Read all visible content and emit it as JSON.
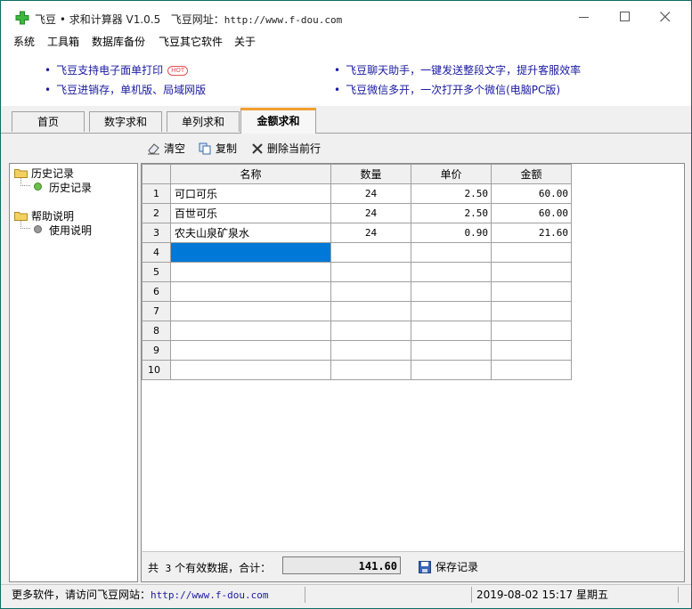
{
  "window": {
    "title": "飞豆 • 求和计算器 V1.0.5",
    "site_label": "飞豆网址：",
    "site_url": "http://www.f-dou.com"
  },
  "menu": [
    "系统",
    "工具箱",
    "数据库备份",
    "飞豆其它软件",
    "关于"
  ],
  "ads": [
    {
      "text": "飞豆支持电子面单打印",
      "badge": "HOT"
    },
    {
      "text": "飞豆聊天助手，一键发送整段文字，提升客服效率"
    },
    {
      "text": "飞豆进销存，单机版、局域网版"
    },
    {
      "text": "飞豆微信多开，一次打开多个微信(电脑PC版)"
    }
  ],
  "tabs": [
    "首页",
    "数字求和",
    "单列求和",
    "金额求和"
  ],
  "active_tab": 3,
  "toolbar": {
    "clear": "清空",
    "copy": "复制",
    "delete_row": "删除当前行"
  },
  "tree": {
    "history_folder": "历史记录",
    "history_item": "历史记录",
    "help_folder": "帮助说明",
    "help_item": "使用说明"
  },
  "grid": {
    "columns": [
      "名称",
      "数量",
      "单价",
      "金额"
    ],
    "rows": [
      {
        "n": "1",
        "name": "可口可乐",
        "qty": "24",
        "price": "2.50",
        "amount": "60.00"
      },
      {
        "n": "2",
        "name": "百世可乐",
        "qty": "24",
        "price": "2.50",
        "amount": "60.00"
      },
      {
        "n": "3",
        "name": "农夫山泉矿泉水",
        "qty": "24",
        "price": "0.90",
        "amount": "21.60"
      },
      {
        "n": "4",
        "name": "",
        "qty": "",
        "price": "",
        "amount": ""
      },
      {
        "n": "5",
        "name": "",
        "qty": "",
        "price": "",
        "amount": ""
      },
      {
        "n": "6",
        "name": "",
        "qty": "",
        "price": "",
        "amount": ""
      },
      {
        "n": "7",
        "name": "",
        "qty": "",
        "price": "",
        "amount": ""
      },
      {
        "n": "8",
        "name": "",
        "qty": "",
        "price": "",
        "amount": ""
      },
      {
        "n": "9",
        "name": "",
        "qty": "",
        "price": "",
        "amount": ""
      },
      {
        "n": "10",
        "name": "",
        "qty": "",
        "price": "",
        "amount": ""
      }
    ]
  },
  "summary": {
    "prefix": "共",
    "count": "3",
    "suffix": "个有效数据，合计：",
    "total": "141.60",
    "save_label": "保存记录"
  },
  "status": {
    "more_text": "更多软件，请访问飞豆网站：",
    "url": "http://www.f-dou.com",
    "datetime": "2019-08-02 15:17 星期五"
  },
  "colors": {
    "selection": "#0078d7",
    "tab_accent": "#f0a030",
    "link": "#1a1aa0",
    "desktop": "#00857a"
  }
}
